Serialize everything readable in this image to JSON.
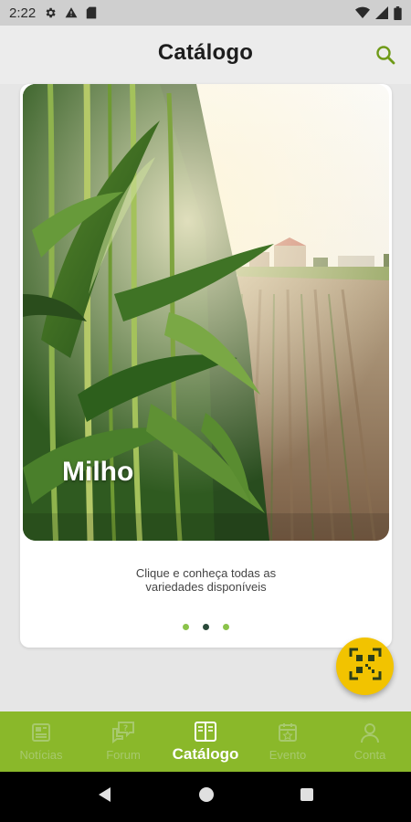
{
  "status_bar": {
    "time": "2:22",
    "icons_left": [
      "gear-icon",
      "warning-icon",
      "sd-card-icon"
    ],
    "icons_right": [
      "wifi-icon",
      "signal-icon",
      "battery-icon"
    ]
  },
  "header": {
    "title": "Catálogo",
    "search_icon": "search-icon"
  },
  "carousel": {
    "card_title": "Milho",
    "description_line1": "Clique e conheça todas as",
    "description_line2": "variedades disponíveis",
    "page_count": 3,
    "active_index": 1
  },
  "fab": {
    "icon": "qr-code-icon"
  },
  "bottom_nav": {
    "items": [
      {
        "label": "Notícias",
        "icon": "newspaper-icon"
      },
      {
        "label": "Forum",
        "icon": "forum-chat-icon"
      },
      {
        "label": "Catálogo",
        "icon": "catalog-book-icon"
      },
      {
        "label": "Evento",
        "icon": "calendar-icon"
      },
      {
        "label": "Conta",
        "icon": "person-icon"
      }
    ],
    "active": "Catálogo"
  },
  "colors": {
    "accent_green": "#8ab82a",
    "fab_yellow": "#f2c300",
    "dot_green": "#8bc34a",
    "dot_active": "#2b4a3a"
  }
}
